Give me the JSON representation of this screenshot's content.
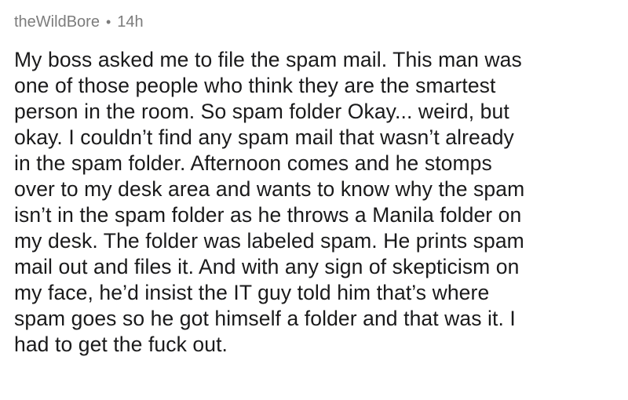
{
  "comment": {
    "username": "theWildBore",
    "separator": "•",
    "timestamp": "14h",
    "lines": [
      "My boss asked me to file the spam mail. This man was",
      "one of those people who think they are the smartest",
      "person in the room. So spam folder Okay... weird, but",
      "okay. I couldn’t find any spam mail that wasn’t already",
      "in the spam folder. Afternoon comes and he stomps",
      "over to my desk area and wants to know why the spam",
      "isn’t in the spam folder as he throws a Manila folder on",
      "my desk. The folder was labeled spam. He prints spam",
      "mail out and files it. And with any sign of skepticism on",
      "my face, he’d insist the IT guy told him that’s where",
      "spam goes so he got himself a folder and that was it. I",
      "had to get the fuck out."
    ]
  }
}
